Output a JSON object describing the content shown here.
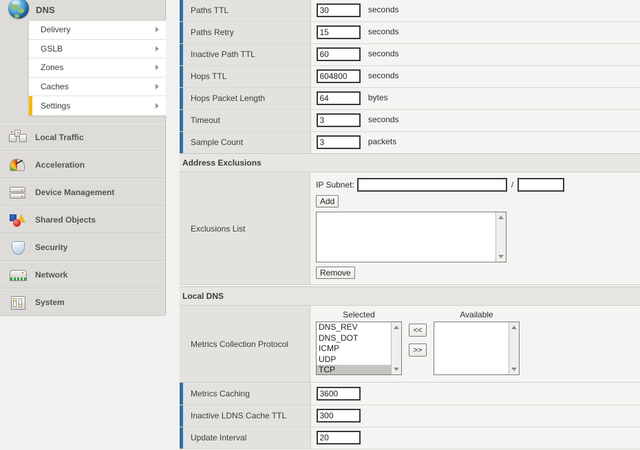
{
  "sidebar": {
    "module": {
      "title": "DNS",
      "icon": "globe-icon"
    },
    "submenu": [
      {
        "label": "Delivery",
        "active": false
      },
      {
        "label": "GSLB",
        "active": false
      },
      {
        "label": "Zones",
        "active": false
      },
      {
        "label": "Caches",
        "active": false
      },
      {
        "label": "Settings",
        "active": true
      }
    ],
    "nav": [
      {
        "label": "Local Traffic",
        "icon": "local-traffic-icon"
      },
      {
        "label": "Acceleration",
        "icon": "acceleration-gauge-icon"
      },
      {
        "label": "Device Management",
        "icon": "device-management-icon"
      },
      {
        "label": "Shared Objects",
        "icon": "shared-objects-icon"
      },
      {
        "label": "Security",
        "icon": "security-shield-icon"
      },
      {
        "label": "Network",
        "icon": "network-switch-icon"
      },
      {
        "label": "System",
        "icon": "system-panel-icon"
      }
    ]
  },
  "main": {
    "probe_fields": [
      {
        "label": "Paths TTL",
        "value": "30",
        "unit": "seconds"
      },
      {
        "label": "Paths Retry",
        "value": "15",
        "unit": "seconds"
      },
      {
        "label": "Inactive Path TTL",
        "value": "60",
        "unit": "seconds"
      },
      {
        "label": "Hops TTL",
        "value": "604800",
        "unit": "seconds"
      },
      {
        "label": "Hops Packet Length",
        "value": "64",
        "unit": "bytes"
      },
      {
        "label": "Timeout",
        "value": "3",
        "unit": "seconds"
      },
      {
        "label": "Sample Count",
        "value": "3",
        "unit": "packets"
      }
    ],
    "address_exclusions": {
      "section_title": "Address Exclusions",
      "row_label": "Exclusions List",
      "ip_subnet_label": "IP Subnet:",
      "ip_subnet_value": "",
      "ip_subnet_placeholder": "",
      "mask_value": "",
      "separator": "/",
      "add_label": "Add",
      "remove_label": "Remove",
      "list_items": []
    },
    "local_dns": {
      "section_title": "Local DNS",
      "metrics_collection": {
        "row_label": "Metrics Collection Protocol",
        "selected_header": "Selected",
        "available_header": "Available",
        "selected_options": [
          {
            "label": "DNS_REV",
            "selected": false
          },
          {
            "label": "DNS_DOT",
            "selected": false
          },
          {
            "label": "ICMP",
            "selected": false
          },
          {
            "label": "UDP",
            "selected": false
          },
          {
            "label": "TCP",
            "selected": true
          }
        ],
        "available_options": [],
        "move_left_label": "<<",
        "move_right_label": ">>"
      },
      "fields": [
        {
          "label": "Metrics Caching",
          "value": "3600",
          "unit": ""
        },
        {
          "label": "Inactive LDNS Cache TTL",
          "value": "300",
          "unit": ""
        },
        {
          "label": "Update Interval",
          "value": "20",
          "unit": ""
        }
      ]
    }
  },
  "colors": {
    "row_marker_blue": "#2f6fa8",
    "active_submenu_marker": "#f5b800",
    "label_column_bg": "#e4e2de",
    "value_column_bg": "#f5f4f2",
    "sidebar_bg": "#dedcd8"
  }
}
